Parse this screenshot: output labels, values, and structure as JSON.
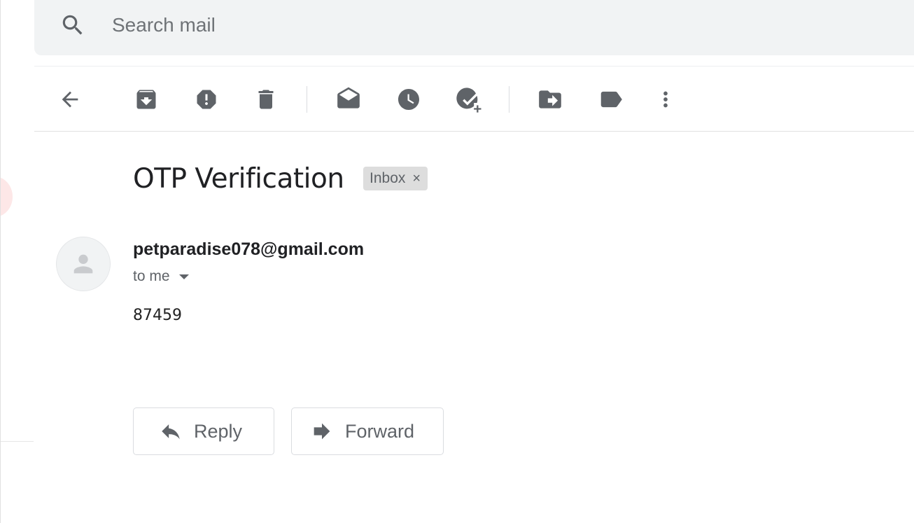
{
  "search": {
    "placeholder": "Search mail",
    "icon": "search-icon"
  },
  "toolbar": {
    "buttons": [
      {
        "name": "back",
        "icon": "arrow-left-icon"
      },
      {
        "name": "archive",
        "icon": "archive-icon"
      },
      {
        "name": "report-spam",
        "icon": "report-spam-icon"
      },
      {
        "name": "delete",
        "icon": "trash-icon"
      },
      {
        "name": "mark-unread",
        "icon": "mark-unread-icon"
      },
      {
        "name": "snooze",
        "icon": "clock-icon"
      },
      {
        "name": "add-to-tasks",
        "icon": "add-task-icon"
      },
      {
        "name": "move-to",
        "icon": "move-to-folder-icon"
      },
      {
        "name": "labels",
        "icon": "label-icon"
      },
      {
        "name": "more",
        "icon": "more-vertical-icon"
      }
    ]
  },
  "message": {
    "subject": "OTP Verification",
    "label": "Inbox",
    "label_remove": "×",
    "sender": "petparadise078@gmail.com",
    "recipient": "to me",
    "body": "87459"
  },
  "actions": {
    "reply_label": "Reply",
    "forward_label": "Forward"
  },
  "colors": {
    "icon": "#5f6368",
    "search_bg": "#f1f3f4",
    "chip_bg": "#dddddd"
  }
}
